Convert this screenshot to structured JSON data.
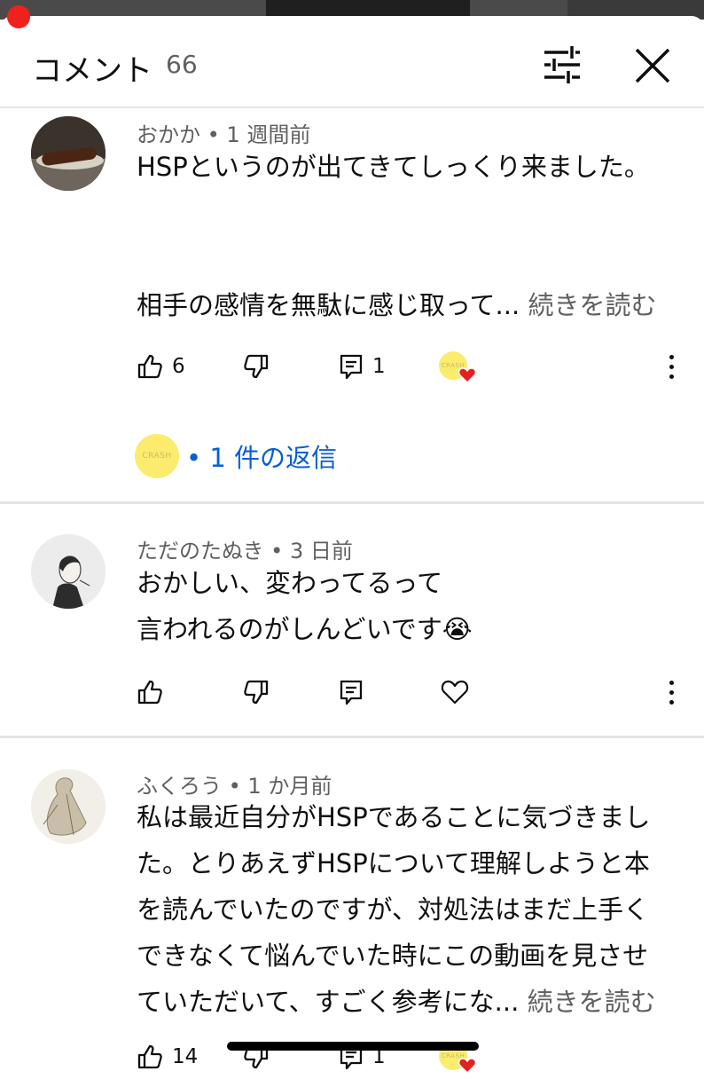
{
  "colors": {
    "accent": "#065fd4",
    "progress": "#f0211c",
    "heart": "#e52020",
    "crash_avatar": "#fbec6e"
  },
  "header": {
    "title": "コメント",
    "count": "66",
    "filter_icon": "sliders-icon",
    "close_icon": "close-icon"
  },
  "comments": [
    {
      "author": "おかか",
      "separator": " • ",
      "time": "1 週間前",
      "lines": [
        "HSPというのが出てきてしっくり来ました。",
        "",
        "",
        "相手の感情を無駄に感じ取って..."
      ],
      "read_more": "続きを読む",
      "likes": "6",
      "reply_count": "1",
      "creator_badge_text": "CRASH",
      "replies_link": "• 1 件の返信",
      "replies_avatar_text": "CRASH"
    },
    {
      "author": "ただのたぬき",
      "separator": " • ",
      "time": "3 日前",
      "lines": [
        "おかしい、変わってるって",
        "言われるのがしんどいです😭"
      ]
    },
    {
      "author": "ふくろう",
      "separator": " • ",
      "time": "1 か月前",
      "lines": [
        "私は最近自分がHSPであることに気づきまし",
        "た。とりあえずHSPについて理解しようと本",
        "を読んでいたのですが、対処法はまだ上手く",
        "できなくて悩んでいた時にこの動画を見させ",
        "ていただいて、すごく参考にな..."
      ],
      "read_more": "続きを読む",
      "likes": "14",
      "reply_count": "1",
      "creator_badge_text": "CRASH"
    }
  ],
  "icons": {
    "like": "thumbs-up-icon",
    "dislike": "thumbs-down-icon",
    "reply": "reply-icon",
    "heart": "heart-icon",
    "more": "more-vertical-icon"
  }
}
